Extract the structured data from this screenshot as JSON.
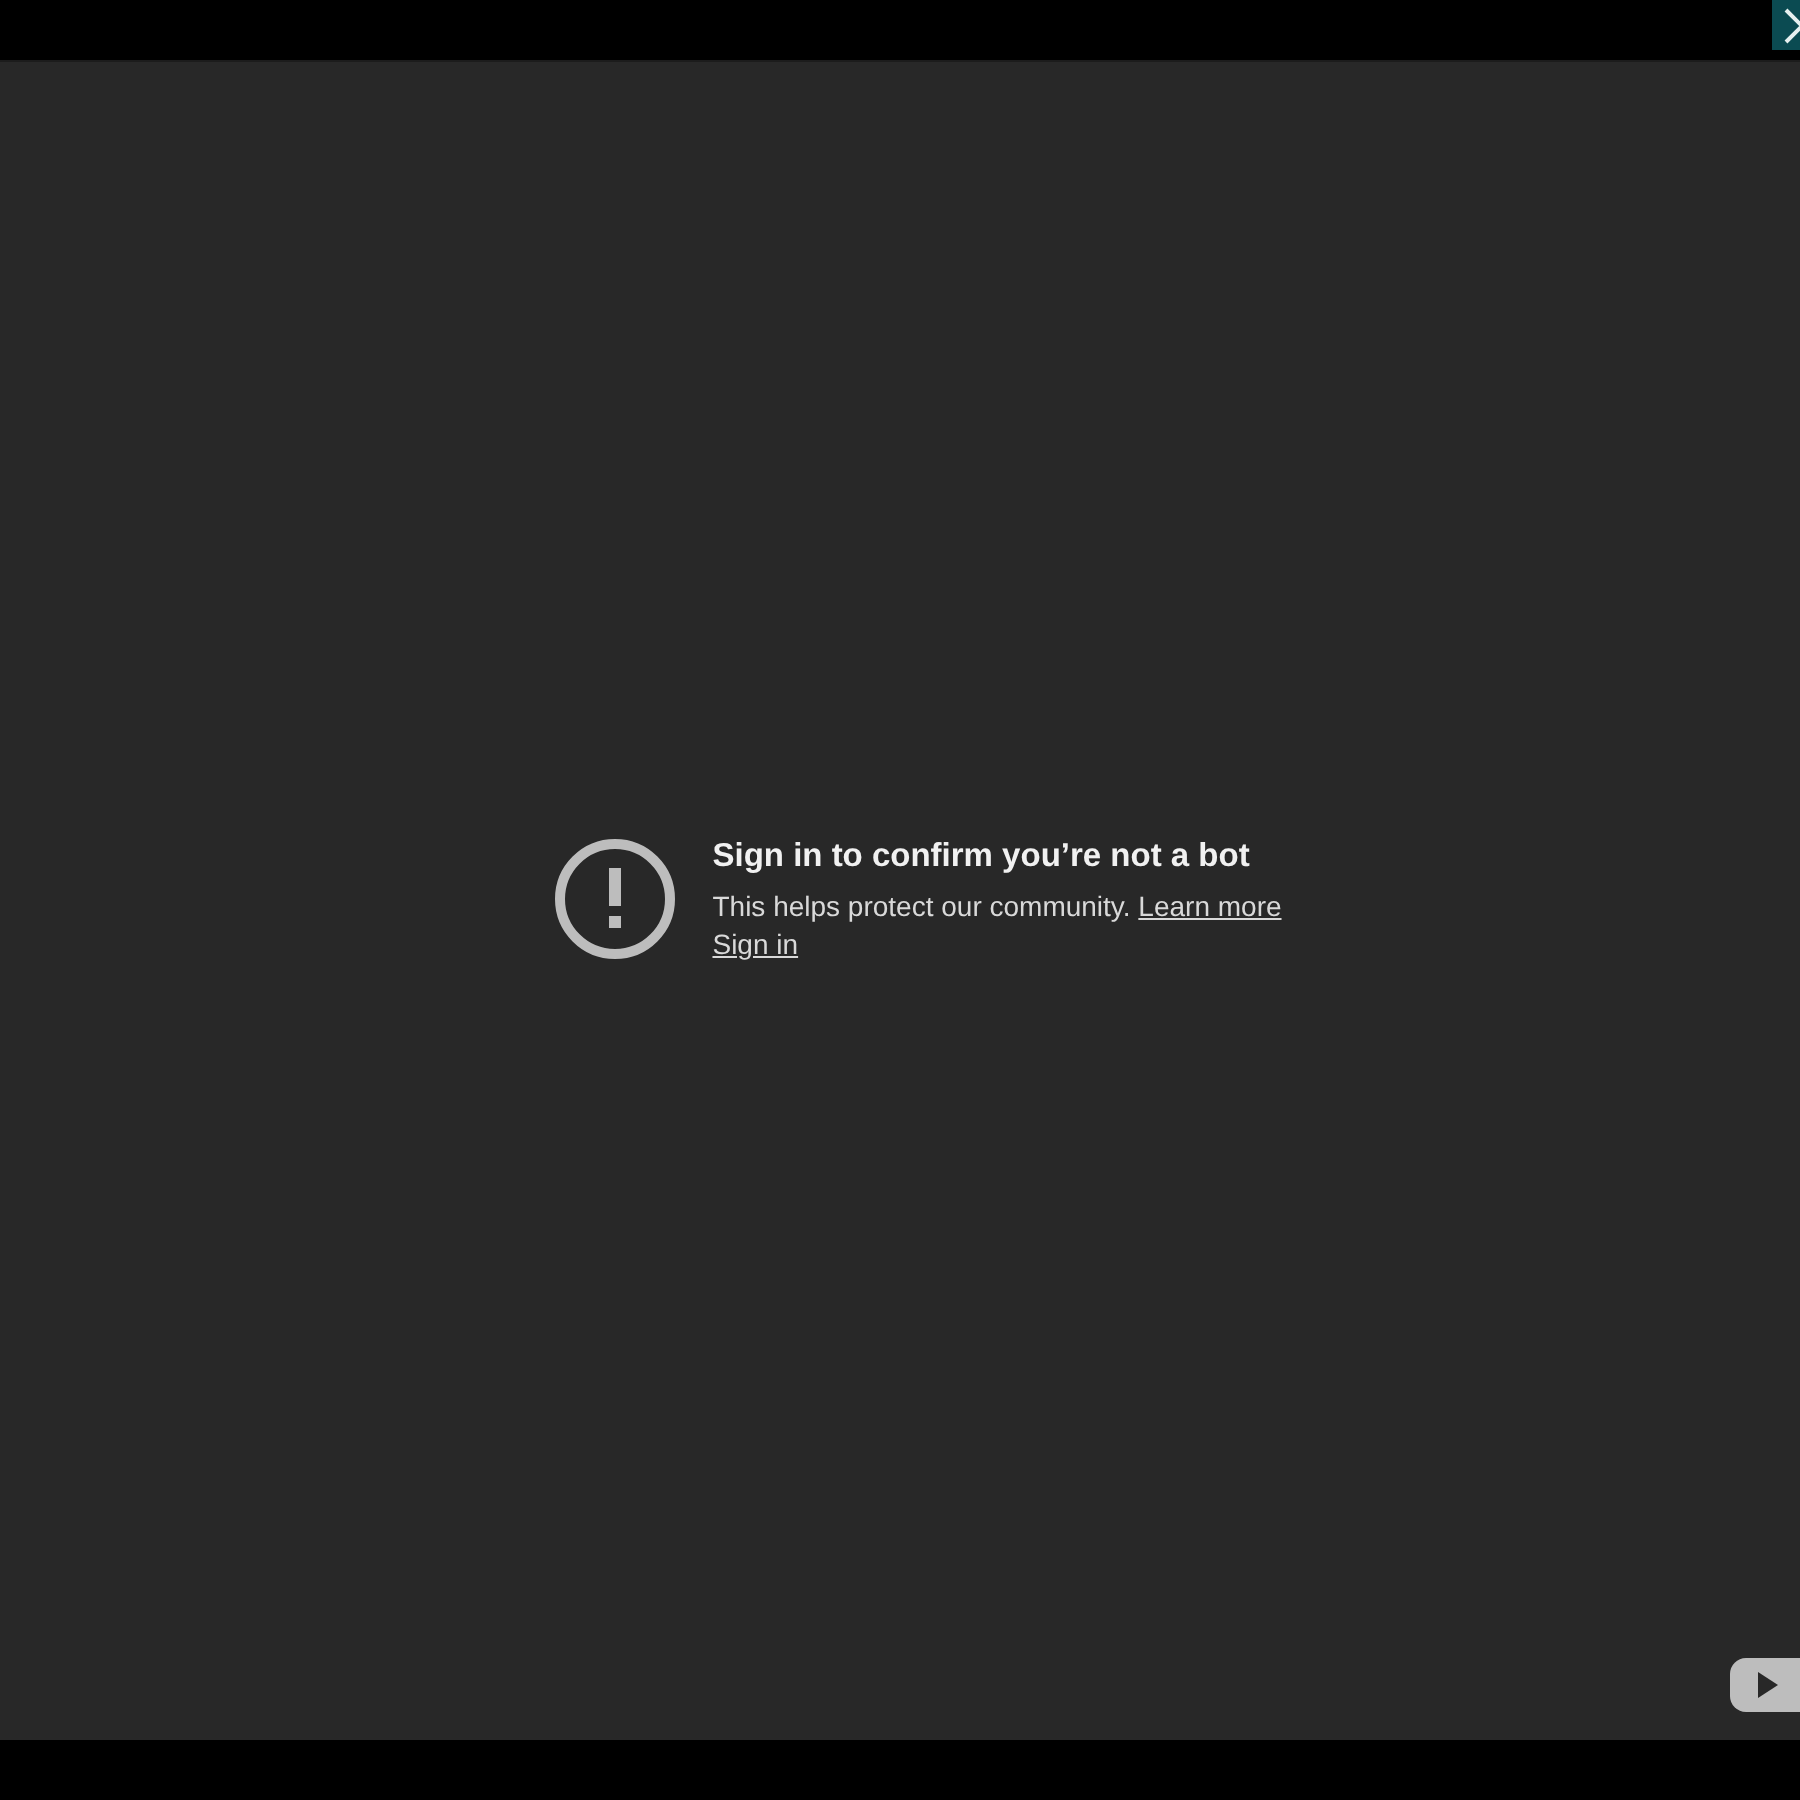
{
  "player": {
    "message": {
      "title": "Sign in to confirm you’re not a bot",
      "body": "This helps protect our community.",
      "learn_more_link": "Learn more",
      "sign_in_link": "Sign in"
    }
  }
}
